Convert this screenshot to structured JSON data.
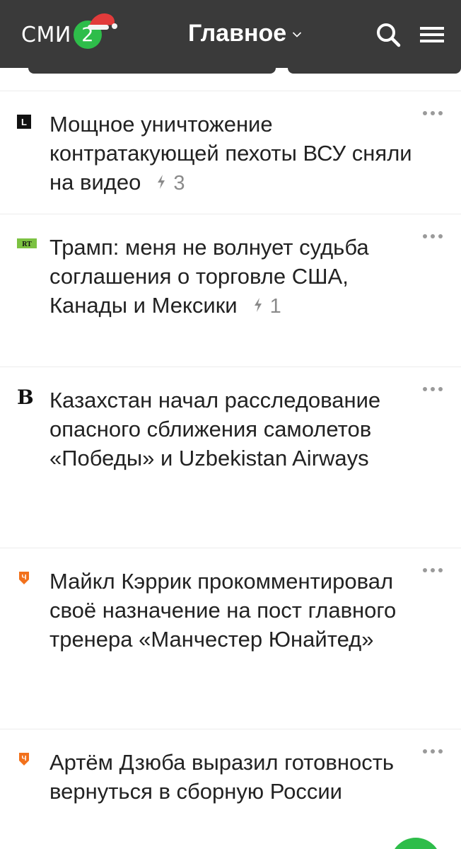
{
  "header": {
    "logo_text": "СМИ",
    "logo_number": "2",
    "title": "Главное",
    "brand_color": "#2ebd4a",
    "bar_color": "#3a3a3a"
  },
  "icons": {
    "search": "search-icon",
    "menu": "hamburger-menu-icon",
    "more": "more-dots-icon",
    "comments": "lightning-icon"
  },
  "news": [
    {
      "source": "L",
      "headline": "Мощное уничтожение контратакующей пехоты ВСУ сняли на видео",
      "count": "3"
    },
    {
      "source": "RT",
      "headline": "Трамп: меня не волнует судьба соглашения о торговле США, Канады и Мексики",
      "count": "1"
    },
    {
      "source": "B",
      "headline": "Казахстан начал расследование опасного сближения самолетов «Победы» и Uzbekistan Airways",
      "count": ""
    },
    {
      "source": "Ч",
      "headline": "Майкл Кэррик прокомментировал своё назначение на пост главного тренера «Манчестер Юнайтед»",
      "count": ""
    },
    {
      "source": "Ч",
      "headline": "Артём Дзюба выразил готовность вернуться в сборную России",
      "count": ""
    }
  ]
}
